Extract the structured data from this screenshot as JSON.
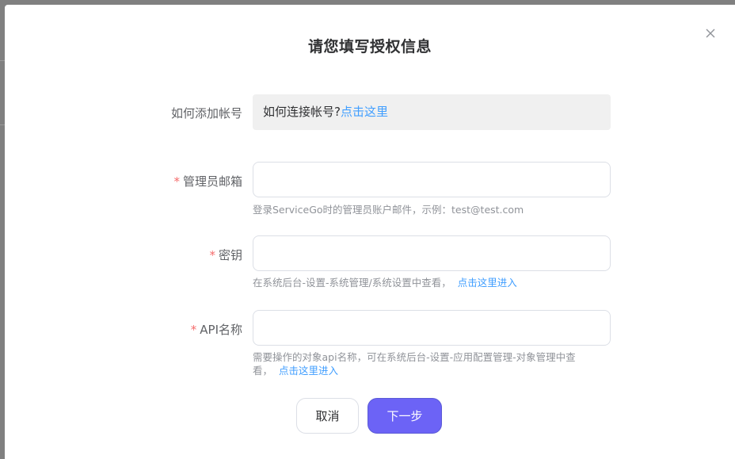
{
  "dialog": {
    "title": "请您填写授权信息"
  },
  "form": {
    "how_to_add": {
      "label": "如何添加帐号",
      "info_text": "如何连接帐号?",
      "info_link": "点击这里"
    },
    "admin_email": {
      "required_mark": "*",
      "label": "管理员邮箱",
      "value": "",
      "hint": "登录ServiceGo时的管理员账户邮件，示例：test@test.com"
    },
    "secret_key": {
      "required_mark": "*",
      "label": "密钥",
      "value": "",
      "hint": "在系统后台-设置-系统管理/系统设置中查看，",
      "hint_link": "点击这里进入"
    },
    "api_name": {
      "required_mark": "*",
      "label": "API名称",
      "value": "",
      "hint_line1": "需要操作的对象api名称，可在系统后台-设置-应用配置管理-对象管理中查",
      "hint_line2": "看，",
      "hint_link": "点击这里进入"
    }
  },
  "buttons": {
    "cancel": "取消",
    "next": "下一步"
  },
  "colors": {
    "link": "#409eff",
    "primary": "#6c63f6",
    "required": "#f56c6c"
  },
  "icons": {
    "close": "close-icon"
  }
}
